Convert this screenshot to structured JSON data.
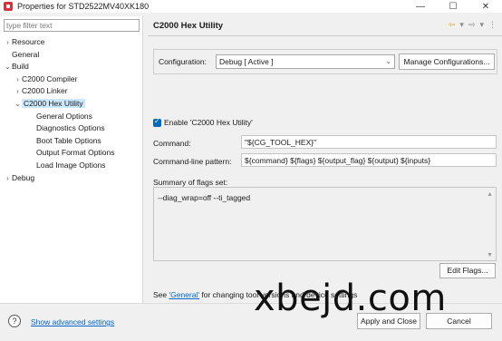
{
  "window": {
    "title": "Properties for STD2522MV40XK180",
    "minimize": "—",
    "maximize": "☐",
    "close": "✕"
  },
  "filter": {
    "placeholder": "type filter text"
  },
  "tree": [
    {
      "label": "Resource",
      "toggle": "›"
    },
    {
      "label": "General",
      "toggle": ""
    },
    {
      "label": "Build",
      "toggle": "⌄"
    },
    {
      "label": "C2000 Compiler",
      "toggle": "›"
    },
    {
      "label": "C2000 Linker",
      "toggle": "›"
    },
    {
      "label": "C2000 Hex Utility",
      "toggle": "⌄"
    },
    {
      "label": "General Options",
      "toggle": ""
    },
    {
      "label": "Diagnostics Options",
      "toggle": ""
    },
    {
      "label": "Boot Table Options",
      "toggle": ""
    },
    {
      "label": "Output Format Options",
      "toggle": ""
    },
    {
      "label": "Load Image Options",
      "toggle": ""
    },
    {
      "label": "Debug",
      "toggle": "›"
    }
  ],
  "page": {
    "title": "C2000 Hex Utility",
    "icons": {
      "back": "⇦",
      "back_menu": "▾",
      "forward": "⇨",
      "forward_menu": "▾",
      "more": "⋮"
    }
  },
  "configuration": {
    "label": "Configuration:",
    "value": "Debug  [ Active ]",
    "chevron": "⌄",
    "manage_label": "Manage Configurations..."
  },
  "enable": {
    "label": "Enable 'C2000 Hex Utility'",
    "checked": true
  },
  "command": {
    "label": "Command:",
    "value": "\"${CG_TOOL_HEX}\""
  },
  "pattern": {
    "label": "Command-line pattern:",
    "value": "${command} ${flags} ${output_flag} ${output} ${inputs}"
  },
  "summary": {
    "label": "Summary of flags set:",
    "text": "--diag_wrap=off --ti_tagged",
    "up": "▲",
    "down": "▼"
  },
  "edit_flags": {
    "label": "Edit Flags..."
  },
  "see": {
    "prefix": "See ",
    "link": "'General'",
    "suffix": " for changing tool versions and device settings"
  },
  "bottom": {
    "help": "?",
    "advanced": "Show advanced settings",
    "apply": "Apply and Close",
    "cancel": "Cancel"
  },
  "watermark": "xbejd.com",
  "colors": {
    "accent": "#0067c0",
    "selection": "#cce8ff",
    "link": "#0066cc",
    "app_icon": "#d1343c"
  }
}
